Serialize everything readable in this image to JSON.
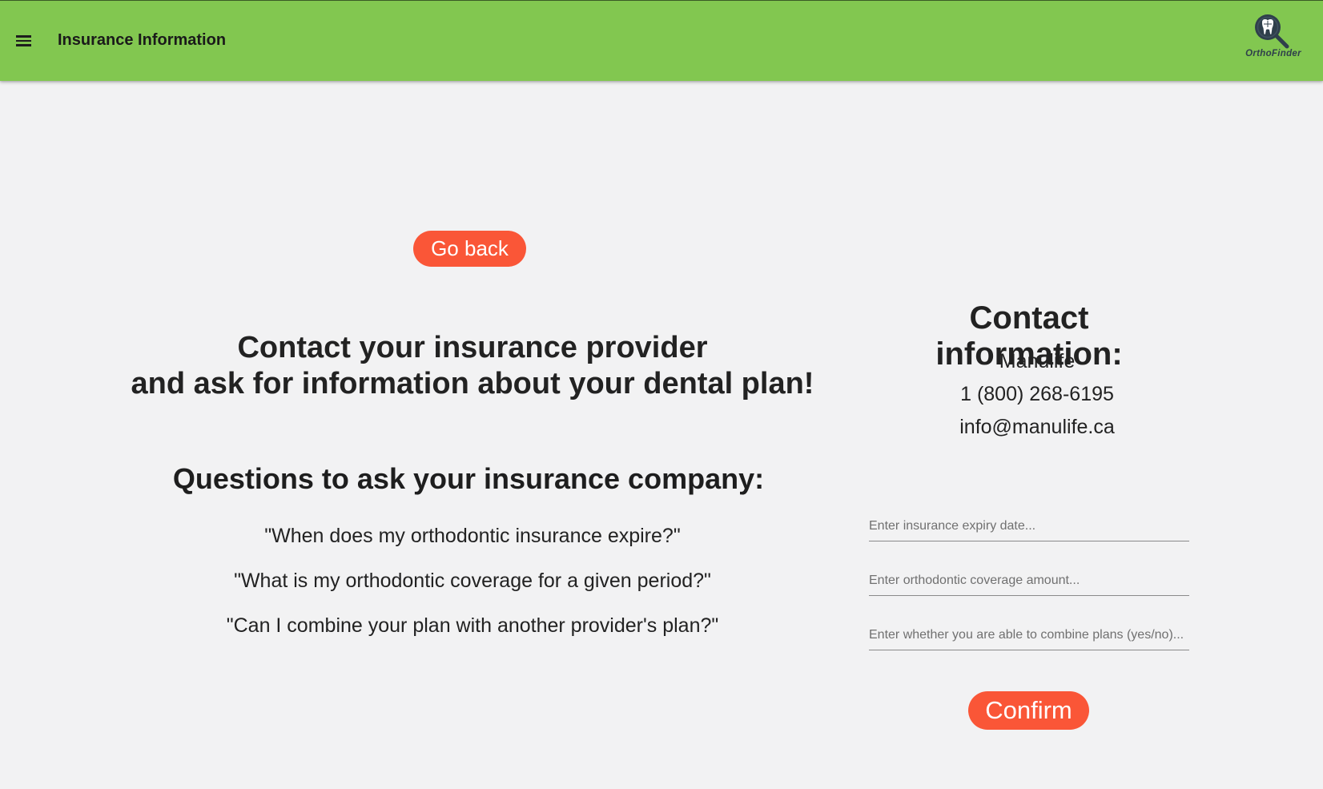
{
  "appbar": {
    "title": "Insurance Information",
    "menu_icon": "hamburger-menu-icon",
    "logo_text": "OrthoFinder",
    "color": "#82c750"
  },
  "actions": {
    "go_back_label": "Go back",
    "confirm_label": "Confirm",
    "button_color": "#fa5637"
  },
  "main": {
    "headline_line1": "Contact your insurance provider",
    "headline_line2": "and ask for information about your dental plan!",
    "questions_heading": "Questions to ask your insurance company:",
    "questions": [
      "\"When does my orthodontic insurance expire?\"",
      "\"What is my orthodontic coverage for a given period?\"",
      "\"Can I combine your plan with another provider's plan?\""
    ]
  },
  "contact": {
    "heading": "Contact information:",
    "company": "Manulife",
    "phone": "1 (800) 268-6195",
    "email": "info@manulife.ca"
  },
  "form": {
    "expiry_placeholder": "Enter insurance expiry date...",
    "coverage_placeholder": "Enter orthodontic coverage amount...",
    "combine_placeholder": "Enter whether you are able to combine plans (yes/no)..."
  }
}
